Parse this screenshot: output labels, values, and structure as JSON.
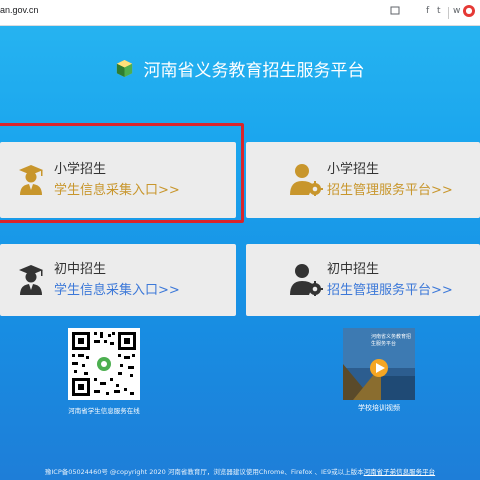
{
  "browser": {
    "url": "an.gov.cn",
    "icons": [
      "share-icon",
      "facebook-icon",
      "twitter-icon",
      "weibo-icon",
      "extension-icon"
    ],
    "facebook_glyph": "f",
    "twitter_glyph": "t",
    "weibo_glyph": "w"
  },
  "header": {
    "title": "河南省义务教育招生服务平台"
  },
  "cards": [
    {
      "category": "小学招生",
      "link_label": "学生信息采集入口>>",
      "icon": "student-icon",
      "link_color": "#c8962c"
    },
    {
      "category": "小学招生",
      "link_label": "招生管理服务平台>>",
      "icon": "admin-gear-icon",
      "link_color": "#c8962c"
    },
    {
      "category": "初中招生",
      "link_label": "学生信息采集入口>>",
      "icon": "student-icon",
      "link_color": "#3c78d8"
    },
    {
      "category": "初中招生",
      "link_label": "招生管理服务平台>>",
      "icon": "admin-gear-icon",
      "link_color": "#3c78d8"
    }
  ],
  "qr": {
    "caption": "河南省学生信息服务在线"
  },
  "video": {
    "caption": "学校培训视频",
    "cover_title": "河南省义务教育招生服务平台"
  },
  "footer": {
    "text": "豫ICP备05024460号 @copyright 2020 河南省教育厅，浏览器建议使用Chrome、Firefox 、IE9或以上版本",
    "link_text": "河南省子弟信息服务平台"
  },
  "colors": {
    "background_top": "#26b3f0",
    "background_bottom": "#1e7ed8",
    "card_bg": "#ececec",
    "highlight": "#d9252b"
  }
}
